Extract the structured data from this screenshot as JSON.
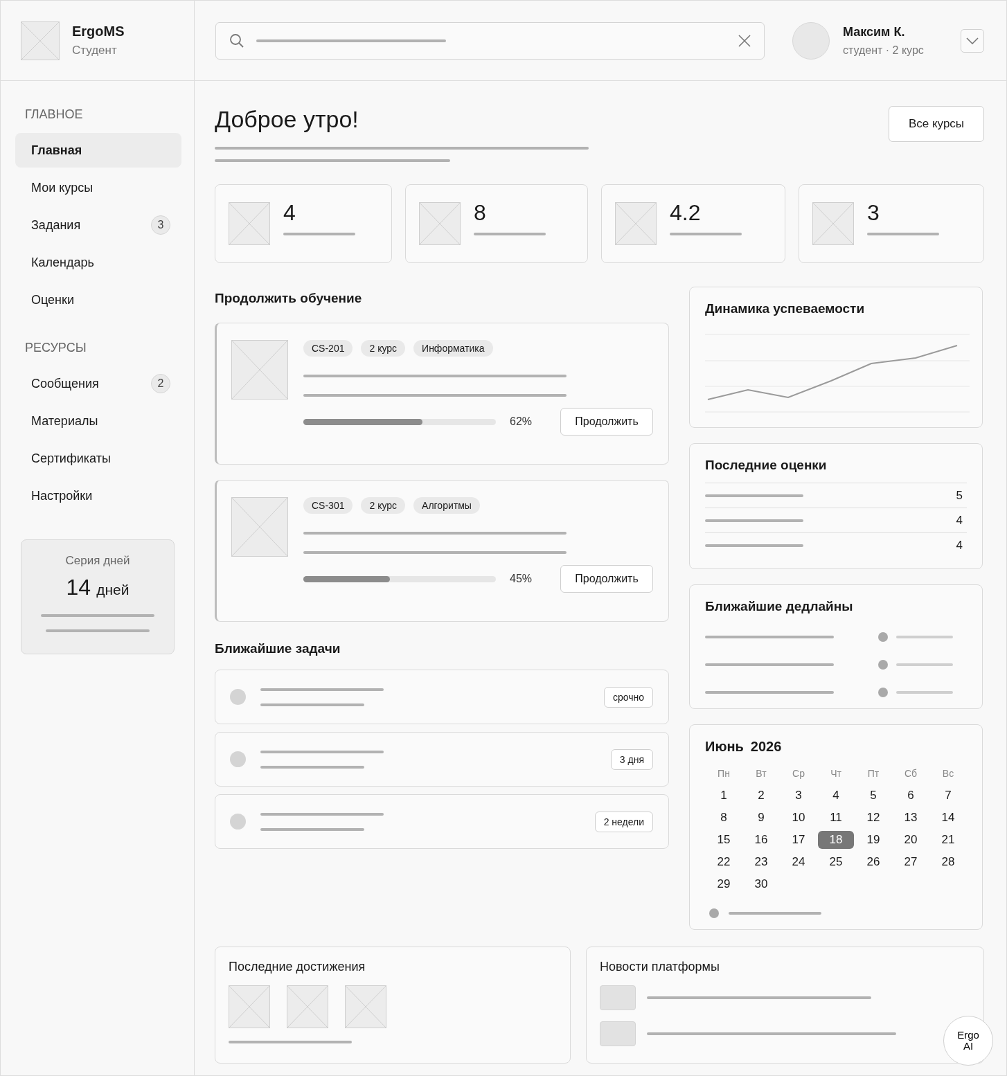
{
  "app": {
    "name": "ErgoMS",
    "role": "Студент"
  },
  "user": {
    "name": "Максим К.",
    "details": "студент · 2 курс"
  },
  "sidebar": {
    "sections": [
      {
        "heading": "ГЛАВНОЕ",
        "items": [
          {
            "label": "Главная",
            "selected": true
          },
          {
            "label": "Мои курсы",
            "selected": false
          },
          {
            "label": "Задания",
            "selected": false,
            "badge": "3"
          },
          {
            "label": "Календарь",
            "selected": false
          },
          {
            "label": "Оценки",
            "selected": false
          }
        ]
      },
      {
        "heading": "РЕСУРСЫ",
        "items": [
          {
            "label": "Сообщения",
            "selected": false,
            "badge": "2"
          },
          {
            "label": "Материалы",
            "selected": false
          },
          {
            "label": "Сертификаты",
            "selected": false
          },
          {
            "label": "Настройки",
            "selected": false
          }
        ]
      }
    ]
  },
  "streak": {
    "title": "Серия дней",
    "value": "14",
    "unit": "дней"
  },
  "greeting": "Доброе утро!",
  "all_courses_button": "Все курсы",
  "stats": [
    {
      "value": "4"
    },
    {
      "value": "8"
    },
    {
      "value": "4.2"
    },
    {
      "value": "3"
    }
  ],
  "continue": {
    "title": "Продолжить обучение",
    "courses": [
      {
        "tags": [
          "CS-201",
          "2 курс",
          "Информатика"
        ],
        "level": 0.62,
        "percent": "62%",
        "button": "Продолжить"
      },
      {
        "tags": [
          "CS-301",
          "2 курс",
          "Алгоритмы"
        ],
        "level": 0.45,
        "percent": "45%",
        "button": "Продолжить"
      }
    ]
  },
  "tasks": {
    "title": "Ближайшие задачи",
    "items": [
      {
        "badge": "срочно"
      },
      {
        "badge": "3 дня"
      },
      {
        "badge": "2 недели"
      }
    ]
  },
  "performance": {
    "title": "Динамика успеваемости"
  },
  "grades": {
    "title": "Последние оценки",
    "items": [
      "5",
      "4",
      "4"
    ]
  },
  "deadlines": {
    "title": "Ближайшие дедлайны"
  },
  "calendar": {
    "month": "Июнь",
    "year": "2026",
    "weekdays": [
      "Пн",
      "Вт",
      "Ср",
      "Чт",
      "Пт",
      "Сб",
      "Вс"
    ],
    "days": [
      {
        "label": "1",
        "selected": false
      },
      {
        "label": "2",
        "selected": false
      },
      {
        "label": "3",
        "selected": false
      },
      {
        "label": "4",
        "selected": false
      },
      {
        "label": "5",
        "selected": false
      },
      {
        "label": "6",
        "selected": false
      },
      {
        "label": "7",
        "selected": false
      },
      {
        "label": "8",
        "selected": false
      },
      {
        "label": "9",
        "selected": false
      },
      {
        "label": "10",
        "selected": false
      },
      {
        "label": "11",
        "selected": false
      },
      {
        "label": "12",
        "selected": false
      },
      {
        "label": "13",
        "selected": false
      },
      {
        "label": "14",
        "selected": false
      },
      {
        "label": "15",
        "selected": false
      },
      {
        "label": "16",
        "selected": false
      },
      {
        "label": "17",
        "selected": false
      },
      {
        "label": "18",
        "selected": true
      },
      {
        "label": "19",
        "selected": false
      },
      {
        "label": "20",
        "selected": false
      },
      {
        "label": "21",
        "selected": false
      },
      {
        "label": "22",
        "selected": false
      },
      {
        "label": "23",
        "selected": false
      },
      {
        "label": "24",
        "selected": false
      },
      {
        "label": "25",
        "selected": false
      },
      {
        "label": "26",
        "selected": false
      },
      {
        "label": "27",
        "selected": false
      },
      {
        "label": "28",
        "selected": false
      },
      {
        "label": "29",
        "selected": false
      },
      {
        "label": "30",
        "selected": false
      }
    ]
  },
  "achievements": {
    "title": "Последние достижения"
  },
  "news": {
    "title": "Новости платформы"
  },
  "assistant": {
    "label": "Ergo AI"
  }
}
